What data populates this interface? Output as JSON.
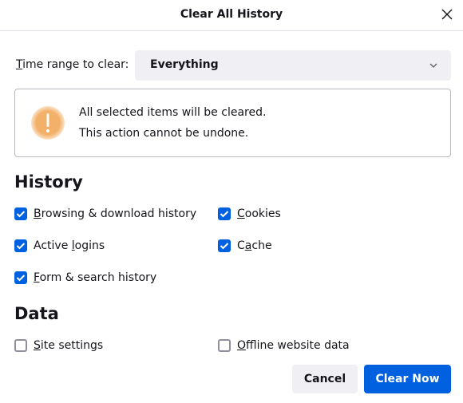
{
  "dialog": {
    "title": "Clear All History",
    "close_icon": "close-icon"
  },
  "time_range": {
    "label_access": "T",
    "label_rest": "ime range to clear:",
    "selected": "Everything",
    "icon": "chevron-down-icon"
  },
  "warning": {
    "icon": "warning-exclamation-icon",
    "line1": "All selected items will be cleared.",
    "line2": "This action cannot be undone."
  },
  "history": {
    "heading": "History",
    "items": [
      {
        "pre": "",
        "key": "B",
        "post": "rowsing & download history",
        "checked": true
      },
      {
        "pre": "",
        "key": "C",
        "post": "ookies",
        "checked": true
      },
      {
        "pre": "Active ",
        "key": "l",
        "post": "ogins",
        "checked": true
      },
      {
        "pre": "C",
        "key": "a",
        "post": "che",
        "checked": true
      },
      {
        "pre": "",
        "key": "F",
        "post": "orm & search history",
        "checked": true
      }
    ]
  },
  "data": {
    "heading": "Data",
    "items": [
      {
        "pre": "",
        "key": "S",
        "post": "ite settings",
        "checked": false
      },
      {
        "pre": "",
        "key": "O",
        "post": "ffline website data",
        "checked": false
      }
    ]
  },
  "buttons": {
    "cancel": "Cancel",
    "clear_now": "Clear Now"
  },
  "colors": {
    "accent": "#0061e0",
    "warning": "#f0a050"
  }
}
